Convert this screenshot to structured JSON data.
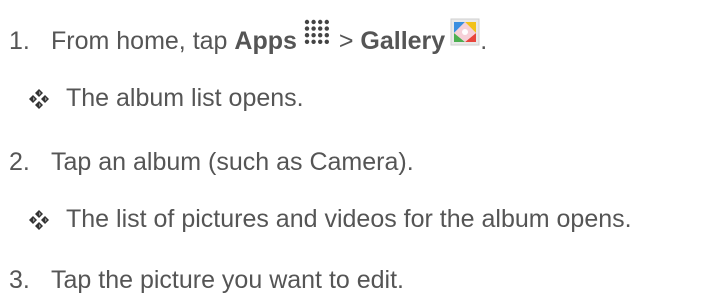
{
  "steps": [
    {
      "number": "1.",
      "text_before": "From home, tap ",
      "bold1": "Apps",
      "icon1": "apps-grid-icon",
      "separator": " > ",
      "bold2": "Gallery",
      "icon2": "gallery-icon",
      "text_after": ".",
      "result": "The album list opens."
    },
    {
      "number": "2.",
      "text": "Tap an album (such as Camera).",
      "result": "The list of pictures and videos for the album opens."
    },
    {
      "number": "3.",
      "text": "Tap the picture you want to edit."
    }
  ],
  "bullet_icon": "diamond-bullet-icon",
  "colors": {
    "text": "#555555",
    "gallery_blue": "#3b8fe0",
    "gallery_yellow": "#f2c21a",
    "gallery_green": "#4caf50",
    "gallery_red": "#e8453c"
  }
}
